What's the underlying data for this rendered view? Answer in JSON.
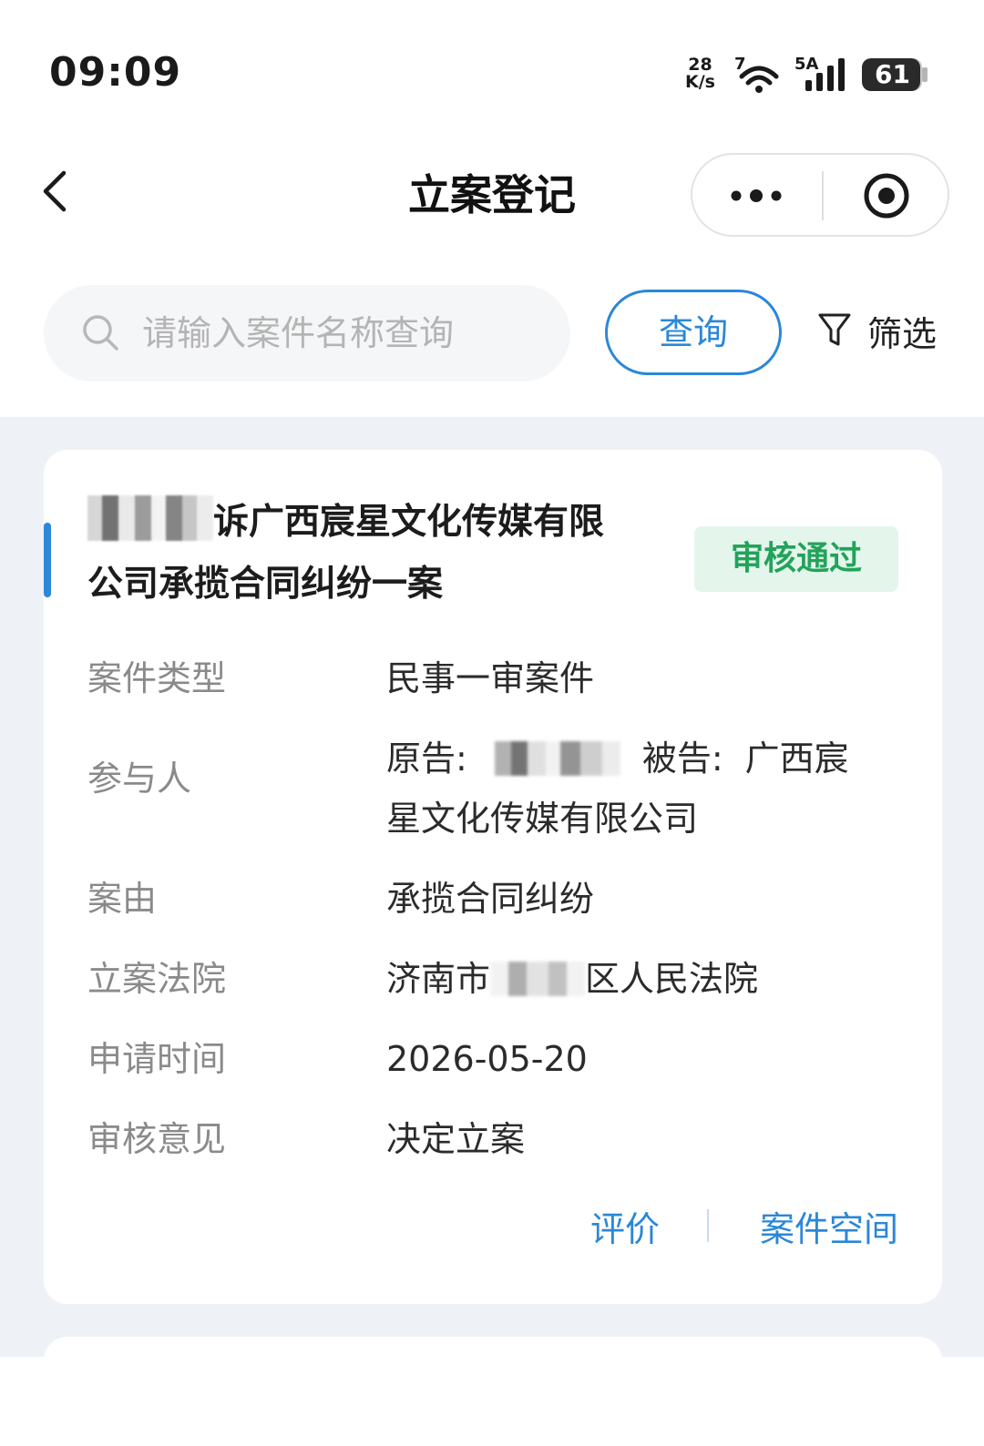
{
  "status_bar": {
    "time": "09:09",
    "net_speed_value": "28",
    "net_speed_unit": "K/s",
    "wifi_label": "7",
    "signal_label": "5A",
    "battery": "61"
  },
  "nav": {
    "title": "立案登记"
  },
  "search": {
    "placeholder": "请输入案件名称查询",
    "value": "",
    "query_label": "查询",
    "filter_label": "筛选"
  },
  "case_card": {
    "title_visible": "诉广西宸星文化传媒有限公司承揽合同纠纷一案",
    "title_part1": "诉广西宸星文化传媒有限",
    "title_part2": "公司承揽合同纠纷一案",
    "status": "审核通过",
    "fields": {
      "case_type": {
        "label": "案件类型",
        "value": "民事一审案件"
      },
      "participants": {
        "label": "参与人",
        "plaintiff_label": "原告:",
        "defendant_label": "被告:",
        "defendant_part1": "广西宸",
        "defendant_part2": "星文化传媒有限公司"
      },
      "cause": {
        "label": "案由",
        "value": "承揽合同纠纷"
      },
      "court": {
        "label": "立案法院",
        "value_prefix": "济南市",
        "value_suffix": "区人民法院"
      },
      "apply_date": {
        "label": "申请时间",
        "value": "2026-05-20"
      },
      "review_opinion": {
        "label": "审核意见",
        "value": "决定立案"
      }
    },
    "actions": {
      "evaluate": "评价",
      "case_space": "案件空间"
    }
  },
  "colors": {
    "accent": "#2b87d8",
    "status_green": "#22a35a",
    "status_green_bg": "#e4f6ec",
    "page_bg": "#eef2f7"
  },
  "icons": [
    "back-arrow-icon",
    "more-dots-icon",
    "close-target-icon",
    "search-icon",
    "filter-funnel-icon",
    "wifi-icon",
    "signal-icon",
    "battery-icon"
  ]
}
